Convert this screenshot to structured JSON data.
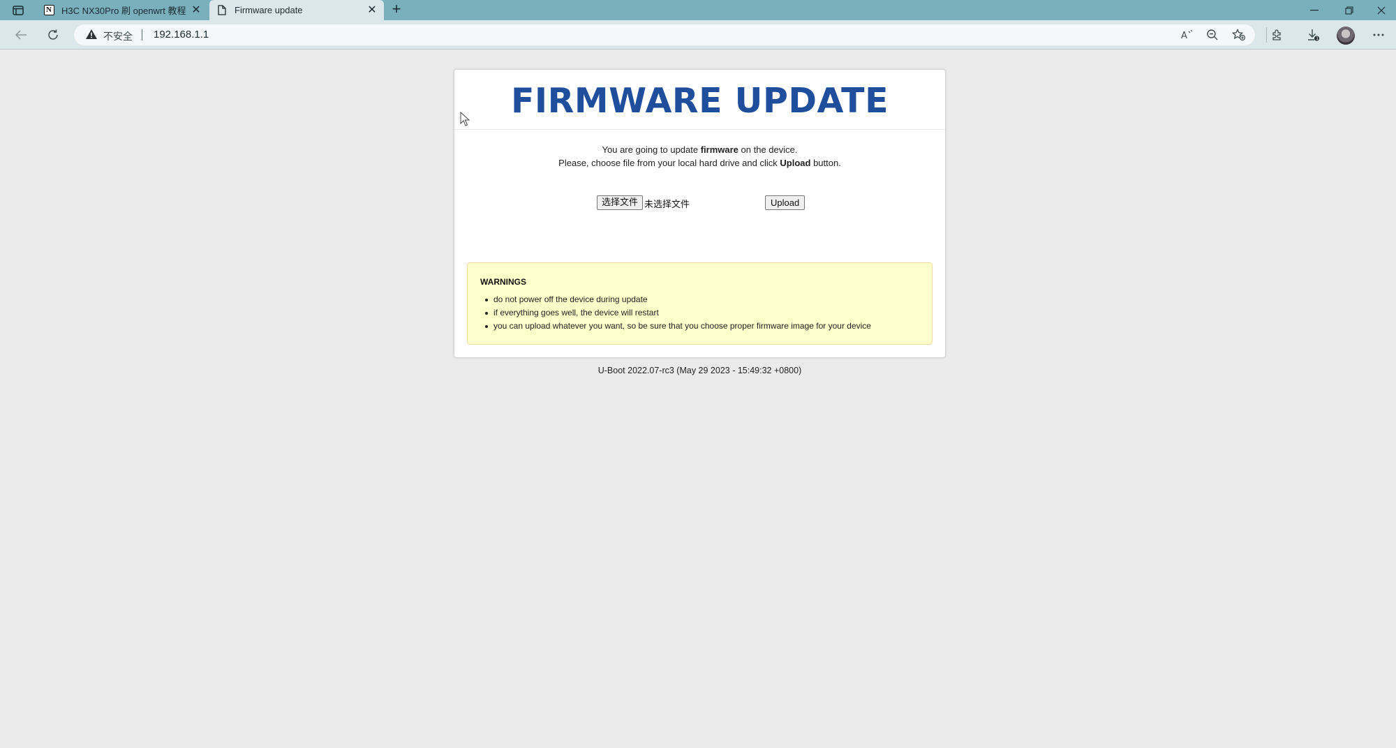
{
  "browser": {
    "tabs": [
      {
        "title": "H3C NX30Pro 刷 openwrt 教程",
        "icon": "notion-icon",
        "active": false
      },
      {
        "title": "Firmware update",
        "icon": "page-icon",
        "active": true
      }
    ],
    "address_bar": {
      "security_label": "不安全",
      "url": "192.168.1.1"
    }
  },
  "page": {
    "title": "FIRMWARE UPDATE",
    "intro": {
      "line1_before": "You are going to update ",
      "line1_bold": "firmware",
      "line1_after": " on the device.",
      "line2_before": "Please, choose file from your local hard drive and click ",
      "line2_bold": "Upload",
      "line2_after": " button."
    },
    "file_input": {
      "button_label": "选择文件",
      "status": "未选择文件"
    },
    "upload_label": "Upload",
    "warnings": {
      "title": "WARNINGS",
      "items": [
        "do not power off the device during update",
        "if everything goes well, the device will restart",
        "you can upload whatever you want, so be sure that you choose proper firmware image for your device"
      ]
    },
    "version": "U-Boot 2022.07-rc3 (May 29 2023 - 15:49:32 +0800)"
  },
  "colors": {
    "title_blue": "#1f4e9d",
    "warning_bg": "#ffffcc",
    "tabbar": "#7aafbc"
  }
}
